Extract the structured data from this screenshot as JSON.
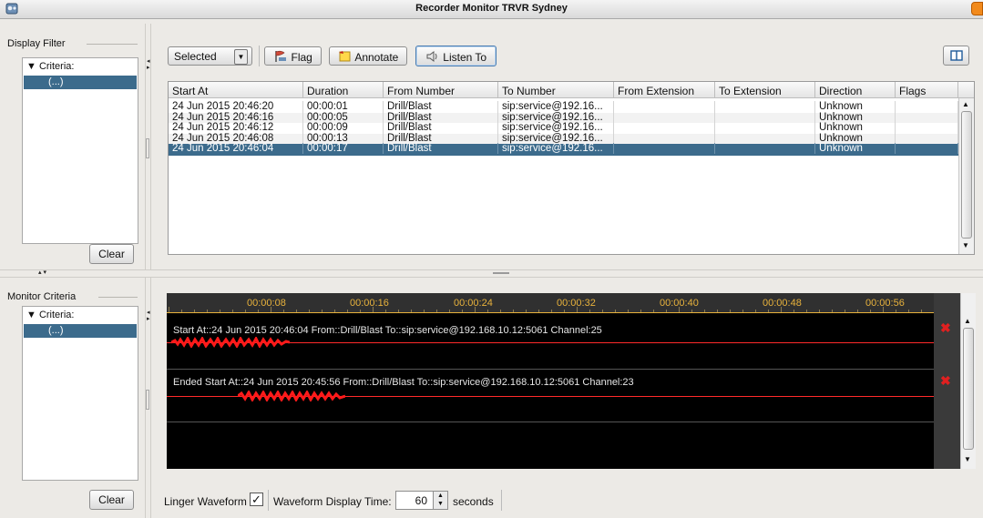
{
  "window": {
    "title": "Recorder Monitor TRVR Sydney"
  },
  "display_filter": {
    "label": "Display Filter",
    "tree_root": "▼ Criteria:",
    "tree_child": "(...)",
    "clear_label": "Clear"
  },
  "monitor_criteria": {
    "label": "Monitor Criteria",
    "tree_root": "▼ Criteria:",
    "tree_child": "(...)",
    "clear_label": "Clear"
  },
  "toolbar": {
    "selection_value": "Selected",
    "flag_label": "Flag",
    "annotate_label": "Annotate",
    "listen_label": "Listen To"
  },
  "table": {
    "columns": [
      "Start At",
      "Duration",
      "From Number",
      "To Number",
      "From Extension",
      "To Extension",
      "Direction",
      "Flags"
    ],
    "rows": [
      [
        "24 Jun 2015 20:46:20",
        "00:00:01",
        "Drill/Blast",
        "sip:service@192.16...",
        "",
        "",
        "Unknown",
        ""
      ],
      [
        "24 Jun 2015 20:46:16",
        "00:00:05",
        "Drill/Blast",
        "sip:service@192.16...",
        "",
        "",
        "Unknown",
        ""
      ],
      [
        "24 Jun 2015 20:46:12",
        "00:00:09",
        "Drill/Blast",
        "sip:service@192.16...",
        "",
        "",
        "Unknown",
        ""
      ],
      [
        "24 Jun 2015 20:46:08",
        "00:00:13",
        "Drill/Blast",
        "sip:service@192.16...",
        "",
        "",
        "Unknown",
        ""
      ],
      [
        "24 Jun 2015 20:46:04",
        "00:00:17",
        "Drill/Blast",
        "sip:service@192.16...",
        "",
        "",
        "Unknown",
        ""
      ]
    ],
    "selected_row": 4
  },
  "timeline": {
    "ticks": [
      "00:00:08",
      "00:00:16",
      "00:00:24",
      "00:00:32",
      "00:00:40",
      "00:00:48",
      "00:00:56"
    ]
  },
  "channels": [
    {
      "text": "Start At::24 Jun 2015 20:46:04    From::Drill/Blast    To::sip:service@192.168.10.12:5061    Channel:25"
    },
    {
      "text": "Ended    Start At::24 Jun 2015 20:45:56    From::Drill/Blast    To::sip:service@192.168.10.12:5061    Channel:23"
    }
  ],
  "footer": {
    "linger_label": "Linger Waveform",
    "linger_checked": true,
    "display_time_label": "Waveform Display Time:",
    "display_time_value": "60",
    "seconds_label": "seconds"
  },
  "colors": {
    "selection": "#3c6b8c",
    "waveform": "#ff1a1a",
    "timeline_text": "#e8b23c",
    "close_icon": "#e02020"
  },
  "icons": {
    "app": "recorder-app-icon",
    "flag": "flag-icon",
    "annotate": "note-icon",
    "listen": "speaker-icon",
    "layout": "panel-layout-icon",
    "close": "close-icon"
  }
}
